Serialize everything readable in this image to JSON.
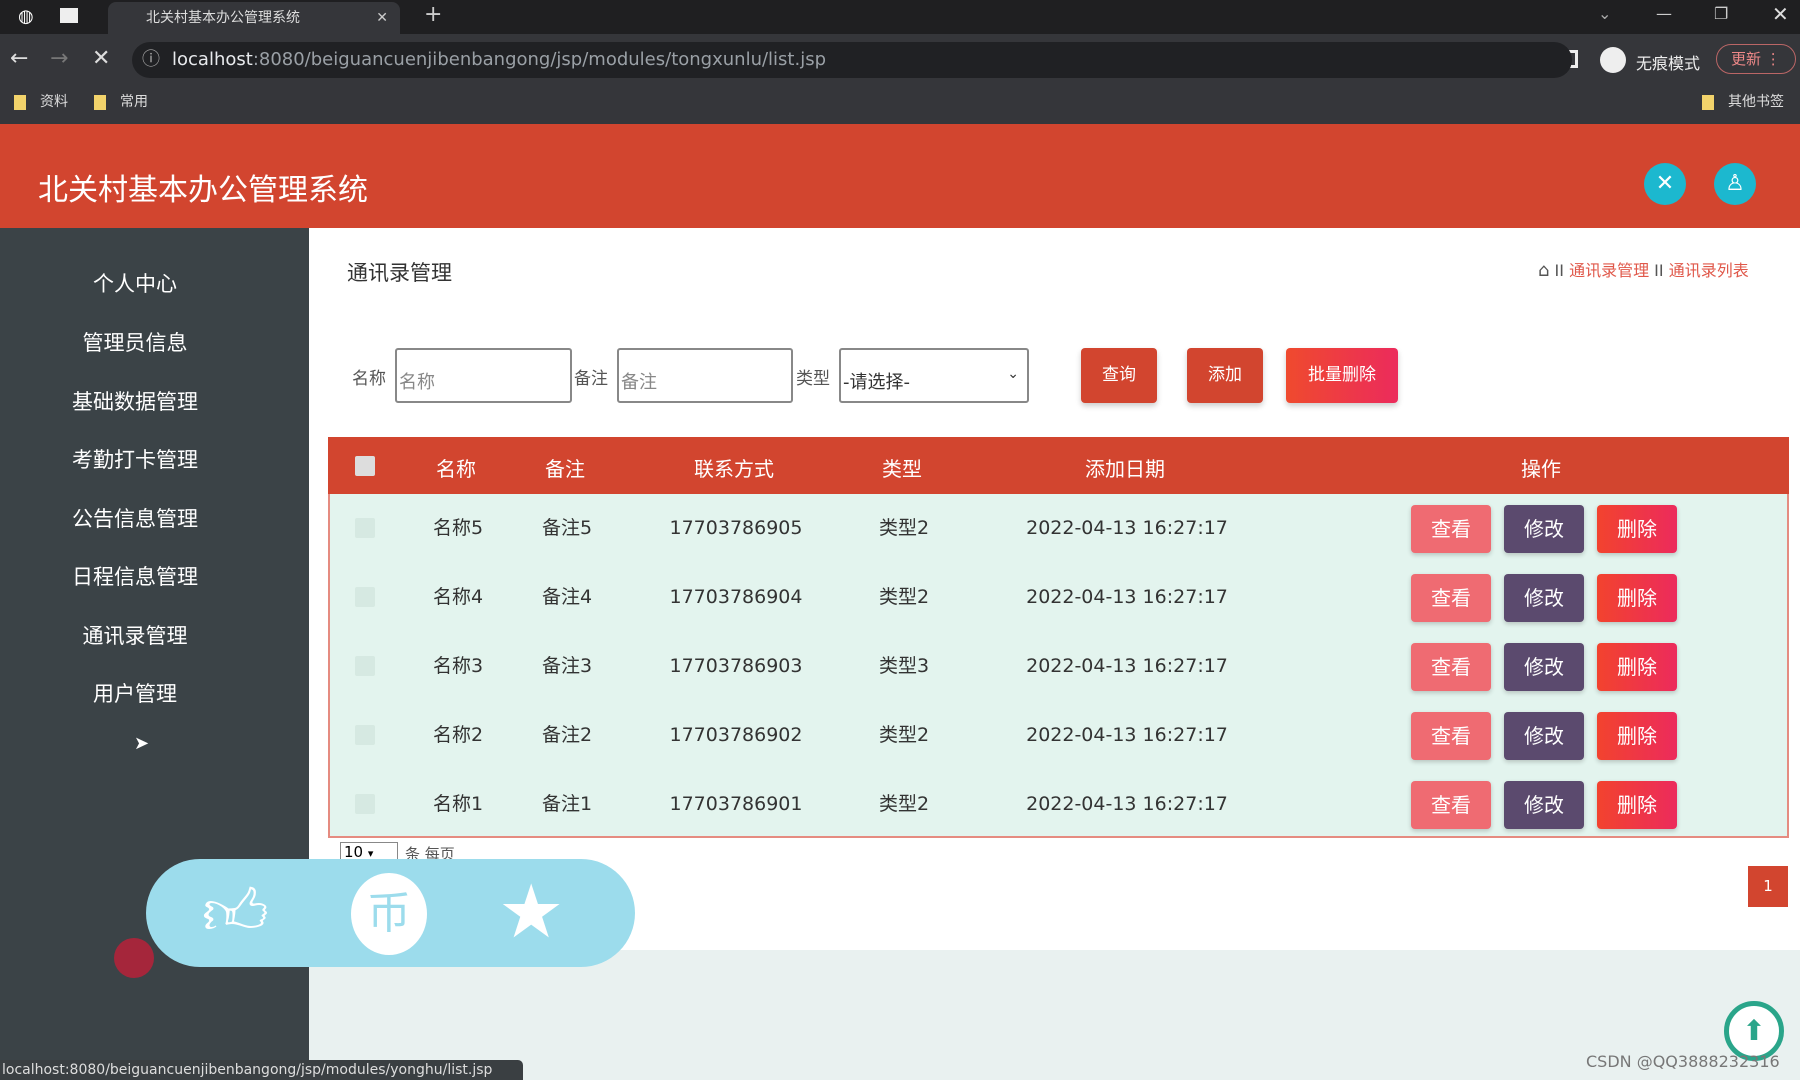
{
  "browser": {
    "tab_title": "北关村基本办公管理系统",
    "url_host": "localhost",
    "url_rest": ":8080/beiguancuenjibenbangong/jsp/modules/tongxunlu/list.jsp",
    "incognito": "无痕模式",
    "update": "更新",
    "bookmarks": [
      "资料",
      "常用"
    ],
    "other_bookmarks": "其他书签",
    "status_url": "localhost:8080/beiguancuenjibenbangong/jsp/modules/yonghu/list.jsp"
  },
  "header": {
    "title": "北关村基本办公管理系统",
    "icons": [
      "fullscreen-icon",
      "user-icon"
    ],
    "color": "#d2452f"
  },
  "sidebar": {
    "items": [
      "个人中心",
      "管理员信息",
      "基础数据管理",
      "考勤打卡管理",
      "公告信息管理",
      "日程信息管理",
      "通讯录管理",
      "用户管理"
    ]
  },
  "page": {
    "title": "通讯录管理",
    "breadcrumb": [
      "通讯录管理",
      "通讯录列表"
    ],
    "sep": "II"
  },
  "search": {
    "name_label": "名称",
    "name_placeholder": "名称",
    "note_label": "备注",
    "note_placeholder": "备注",
    "type_label": "类型",
    "type_selected": "-请选择-",
    "query": "查询",
    "add": "添加",
    "batch_delete": "批量删除"
  },
  "table": {
    "headers": [
      "名称",
      "备注",
      "联系方式",
      "类型",
      "添加日期",
      "操作"
    ],
    "rows": [
      [
        "名称5",
        "备注5",
        "17703786905",
        "类型2",
        "2022-04-13 16:27:17"
      ],
      [
        "名称4",
        "备注4",
        "17703786904",
        "类型2",
        "2022-04-13 16:27:17"
      ],
      [
        "名称3",
        "备注3",
        "17703786903",
        "类型3",
        "2022-04-13 16:27:17"
      ],
      [
        "名称2",
        "备注2",
        "17703786902",
        "类型2",
        "2022-04-13 16:27:17"
      ],
      [
        "名称1",
        "备注1",
        "17703786901",
        "类型2",
        "2022-04-13 16:27:17"
      ]
    ],
    "actions": [
      "查看",
      "修改",
      "删除"
    ]
  },
  "pagination": {
    "page_size": "10",
    "per_page_label": "条 每页",
    "current_page": "1"
  },
  "watermark": "CSDN @QQ3888232316"
}
